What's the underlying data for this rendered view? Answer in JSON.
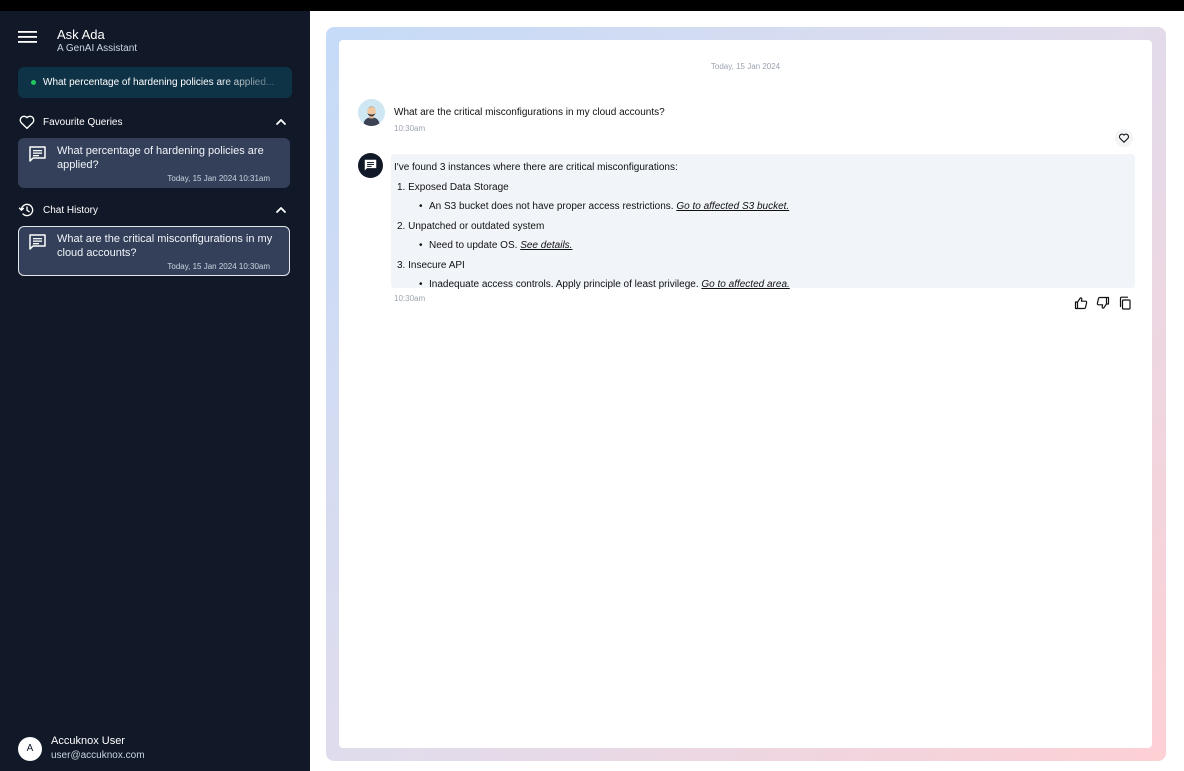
{
  "app": {
    "title": "Ask Ada",
    "subtitle": "A GenAI Assistant"
  },
  "active_query": {
    "text": "What percentage of hardening policies are applied..."
  },
  "favourites": {
    "label": "Favourite Queries",
    "items": [
      {
        "title": "What percentage of hardening policies are applied?",
        "time": "Today, 15 Jan 2024 10:31am"
      }
    ]
  },
  "history": {
    "label": "Chat History",
    "items": [
      {
        "title": "What are the critical misconfigurations in my cloud accounts?",
        "time": "Today, 15 Jan 2024 10:30am"
      }
    ]
  },
  "user": {
    "initial": "A",
    "name": "Accuknox User",
    "email": "user@accuknox.com"
  },
  "chat": {
    "date": "Today, 15 Jan 2024",
    "user_message": {
      "text": "What are the critical misconfigurations in my cloud accounts?",
      "time": "10:30am"
    },
    "bot_message": {
      "intro": "I've found 3 instances where there are critical misconfigurations:",
      "items": [
        {
          "num": "1.",
          "title": "Exposed Data Storage",
          "detail": "An S3 bucket does not have proper access restrictions.",
          "link": "Go to affected S3 bucket."
        },
        {
          "num": "2.",
          "title": "Unpatched or outdated system",
          "detail": "Need to update OS.",
          "link": "See details."
        },
        {
          "num": "3.",
          "title": "Insecure API",
          "detail": "Inadequate access controls. Apply principle of least privilege.",
          "link": "Go to affected area."
        }
      ],
      "time": "10:30am"
    }
  },
  "colors": {
    "sidebar_bg": "#111827",
    "card_bg": "#34405a",
    "active_query_bg": "#0f3346",
    "status_dot": "#22c55e",
    "bot_bubble_bg": "#f1f5f9"
  },
  "icons": {
    "menu": "hamburger-menu-icon",
    "favourites": "heart-icon",
    "history": "history-clock-icon",
    "collapse": "chevron-up-icon",
    "query": "chat-message-icon",
    "favourite_action": "heart-outline-icon",
    "like": "thumbs-up-icon",
    "dislike": "thumbs-down-icon",
    "copy": "copy-icon"
  }
}
